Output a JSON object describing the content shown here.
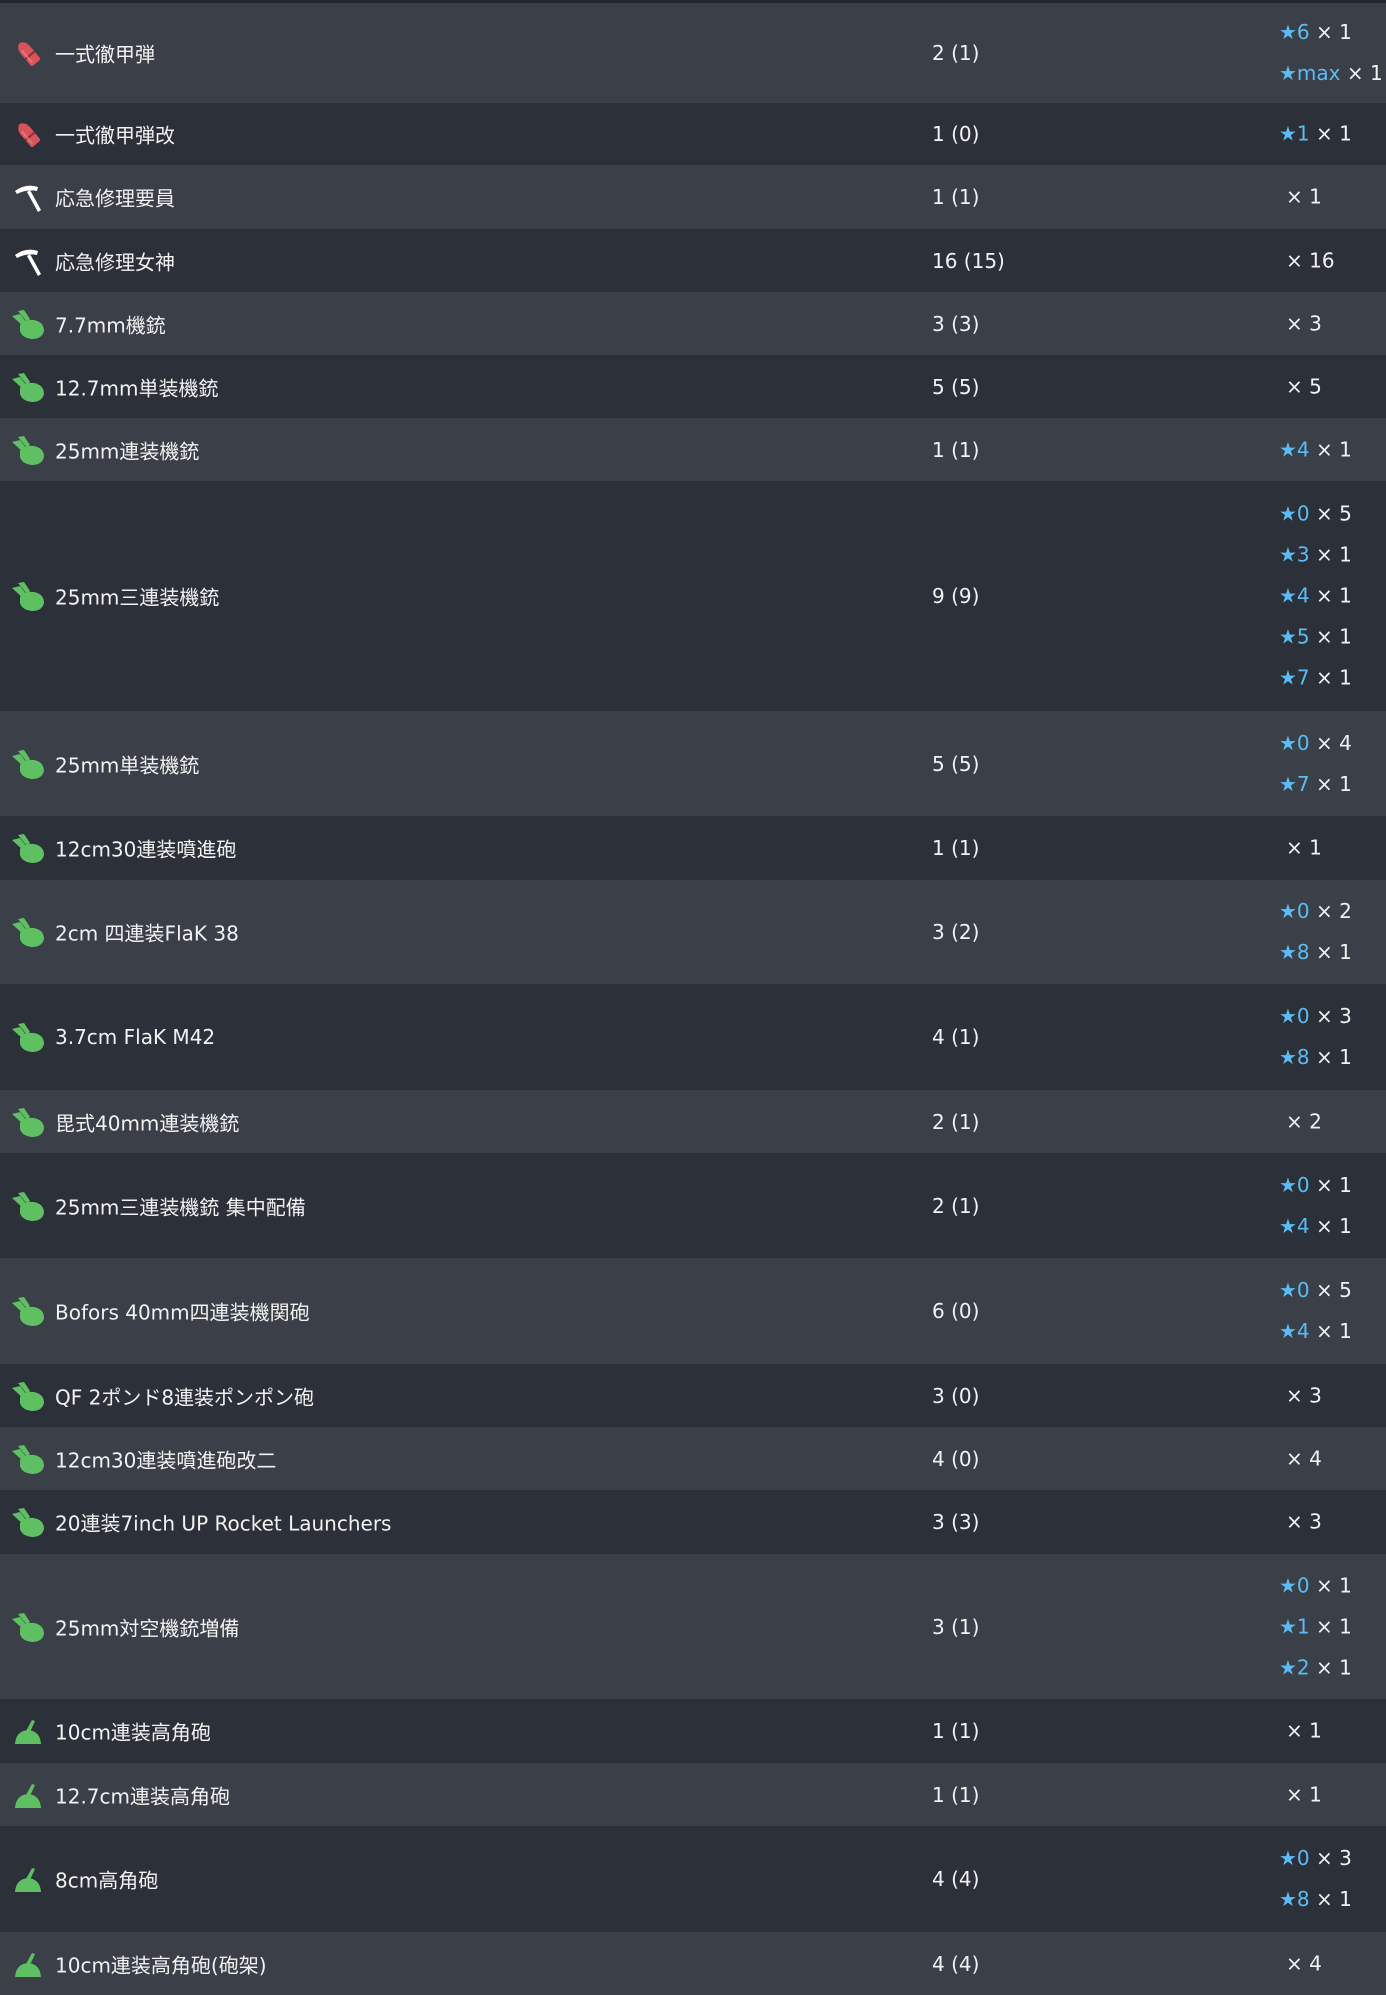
{
  "colors": {
    "row_odd": "#3a3f48",
    "row_even": "#2c3039",
    "text": "#f2f2f2",
    "star": "#5bbcf5",
    "shell_icon": "#d9535b",
    "aa_gun_icon": "#5fbf63"
  },
  "items": [
    {
      "icon": "ap-shell-icon",
      "name": "一式徹甲弾",
      "count": "2 (1)",
      "improvements": [
        {
          "star": "★6",
          "qty": "× 1"
        },
        {
          "star": "★max",
          "qty": "× 1"
        }
      ]
    },
    {
      "icon": "ap-shell-icon",
      "name": "一式徹甲弾改",
      "count": "1 (0)",
      "improvements": [
        {
          "star": "★1",
          "qty": "× 1"
        }
      ]
    },
    {
      "icon": "repair-tool-icon",
      "name": "応急修理要員",
      "count": "1 (1)",
      "improvements": [
        {
          "star": "",
          "qty": "× 1"
        }
      ]
    },
    {
      "icon": "repair-tool-icon",
      "name": "応急修理女神",
      "count": "16 (15)",
      "improvements": [
        {
          "star": "",
          "qty": "× 16"
        }
      ]
    },
    {
      "icon": "aa-machine-gun-icon",
      "name": "7.7mm機銃",
      "count": "3 (3)",
      "improvements": [
        {
          "star": "",
          "qty": "× 3"
        }
      ]
    },
    {
      "icon": "aa-machine-gun-icon",
      "name": "12.7mm単装機銃",
      "count": "5 (5)",
      "improvements": [
        {
          "star": "",
          "qty": "× 5"
        }
      ]
    },
    {
      "icon": "aa-machine-gun-icon",
      "name": "25mm連装機銃",
      "count": "1 (1)",
      "improvements": [
        {
          "star": "★4",
          "qty": "× 1"
        }
      ]
    },
    {
      "icon": "aa-machine-gun-icon",
      "name": "25mm三連装機銃",
      "count": "9 (9)",
      "improvements": [
        {
          "star": "★0",
          "qty": "× 5"
        },
        {
          "star": "★3",
          "qty": "× 1"
        },
        {
          "star": "★4",
          "qty": "× 1"
        },
        {
          "star": "★5",
          "qty": "× 1"
        },
        {
          "star": "★7",
          "qty": "× 1"
        }
      ]
    },
    {
      "icon": "aa-machine-gun-icon",
      "name": "25mm単装機銃",
      "count": "5 (5)",
      "improvements": [
        {
          "star": "★0",
          "qty": "× 4"
        },
        {
          "star": "★7",
          "qty": "× 1"
        }
      ]
    },
    {
      "icon": "aa-machine-gun-icon",
      "name": "12cm30連装噴進砲",
      "count": "1 (1)",
      "improvements": [
        {
          "star": "",
          "qty": "× 1"
        }
      ]
    },
    {
      "icon": "aa-machine-gun-icon",
      "name": "2cm 四連装FlaK 38",
      "count": "3 (2)",
      "improvements": [
        {
          "star": "★0",
          "qty": "× 2"
        },
        {
          "star": "★8",
          "qty": "× 1"
        }
      ]
    },
    {
      "icon": "aa-machine-gun-icon",
      "name": "3.7cm FlaK M42",
      "count": "4 (1)",
      "improvements": [
        {
          "star": "★0",
          "qty": "× 3"
        },
        {
          "star": "★8",
          "qty": "× 1"
        }
      ]
    },
    {
      "icon": "aa-machine-gun-icon",
      "name": "毘式40mm連装機銃",
      "count": "2 (1)",
      "improvements": [
        {
          "star": "",
          "qty": "× 2"
        }
      ]
    },
    {
      "icon": "aa-machine-gun-icon",
      "name": "25mm三連装機銃 集中配備",
      "count": "2 (1)",
      "improvements": [
        {
          "star": "★0",
          "qty": "× 1"
        },
        {
          "star": "★4",
          "qty": "× 1"
        }
      ]
    },
    {
      "icon": "aa-machine-gun-icon",
      "name": "Bofors 40mm四連装機関砲",
      "count": "6 (0)",
      "improvements": [
        {
          "star": "★0",
          "qty": "× 5"
        },
        {
          "star": "★4",
          "qty": "× 1"
        }
      ]
    },
    {
      "icon": "aa-machine-gun-icon",
      "name": "QF 2ポンド8連装ポンポン砲",
      "count": "3 (0)",
      "improvements": [
        {
          "star": "",
          "qty": "× 3"
        }
      ]
    },
    {
      "icon": "aa-machine-gun-icon",
      "name": "12cm30連装噴進砲改二",
      "count": "4 (0)",
      "improvements": [
        {
          "star": "",
          "qty": "× 4"
        }
      ]
    },
    {
      "icon": "aa-machine-gun-icon",
      "name": "20連装7inch UP Rocket Launchers",
      "count": "3 (3)",
      "improvements": [
        {
          "star": "",
          "qty": "× 3"
        }
      ]
    },
    {
      "icon": "aa-machine-gun-icon",
      "name": "25mm対空機銃増備",
      "count": "3 (1)",
      "improvements": [
        {
          "star": "★0",
          "qty": "× 1"
        },
        {
          "star": "★1",
          "qty": "× 1"
        },
        {
          "star": "★2",
          "qty": "× 1"
        }
      ]
    },
    {
      "icon": "high-angle-gun-icon",
      "name": "10cm連装高角砲",
      "count": "1 (1)",
      "improvements": [
        {
          "star": "",
          "qty": "× 1"
        }
      ]
    },
    {
      "icon": "high-angle-gun-icon",
      "name": "12.7cm連装高角砲",
      "count": "1 (1)",
      "improvements": [
        {
          "star": "",
          "qty": "× 1"
        }
      ]
    },
    {
      "icon": "high-angle-gun-icon",
      "name": "8cm高角砲",
      "count": "4 (4)",
      "improvements": [
        {
          "star": "★0",
          "qty": "× 3"
        },
        {
          "star": "★8",
          "qty": "× 1"
        }
      ]
    },
    {
      "icon": "high-angle-gun-icon",
      "name": "10cm連装高角砲(砲架)",
      "count": "4 (4)",
      "improvements": [
        {
          "star": "",
          "qty": "× 4"
        }
      ]
    }
  ]
}
